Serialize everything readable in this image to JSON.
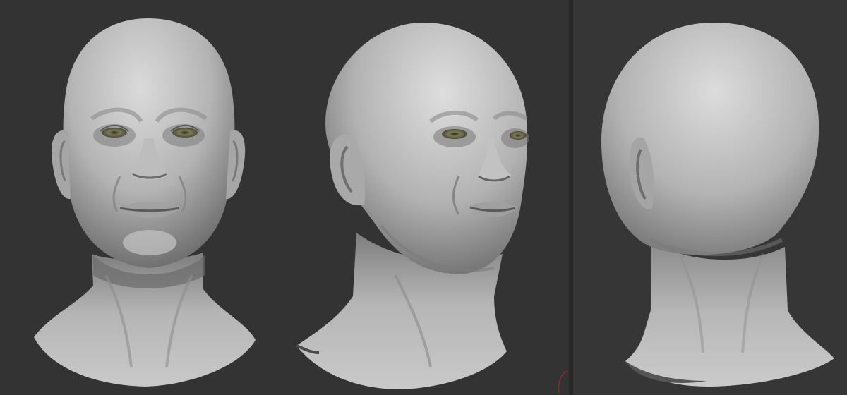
{
  "render": {
    "views": [
      {
        "view": "front",
        "label": ""
      },
      {
        "view": "three-quarter",
        "label": ""
      },
      {
        "view": "back",
        "label": ""
      }
    ],
    "material": "grey clay",
    "colors": {
      "background_left": "#333333",
      "background_right": "#363636",
      "divider": "#262626",
      "clay_light": "#d4d4d4",
      "clay_mid": "#a9a9a9",
      "clay_dark": "#5e5e5e",
      "eye_iris": "#7d7a55",
      "accent_mark": "#8a2a2a"
    }
  }
}
